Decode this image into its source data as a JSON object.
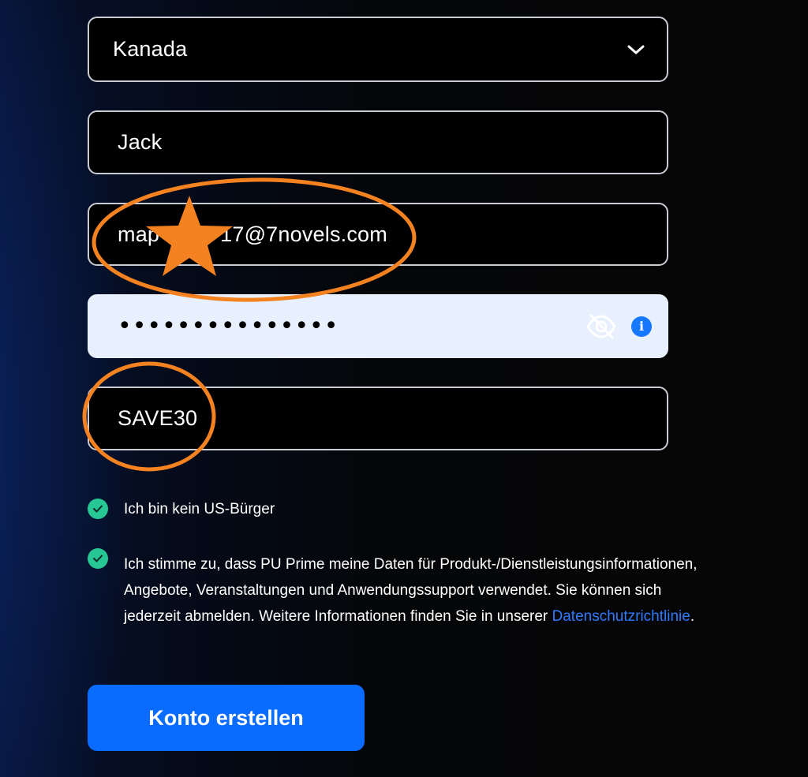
{
  "form": {
    "country": {
      "value": "Kanada"
    },
    "first_name": {
      "value": "Jack"
    },
    "email": {
      "value": "map          17@7novels.com"
    },
    "password": {
      "masked_value": "•••••••••••••••"
    },
    "promo_code": {
      "value": "SAVE30"
    }
  },
  "consents": [
    {
      "checked": true,
      "text": "Ich bin kein US-Bürger"
    },
    {
      "checked": true,
      "text": "Ich stimme zu, dass PU Prime meine Daten für Produkt-/Dienstleistungsinformationen, Angebote, Veranstaltungen und Anwendungssupport verwendet. Sie können sich jederzeit abmelden. Weitere Informationen finden Sie in unserer ",
      "link_text": "Datenschutzrichtlinie",
      "trailing": "."
    }
  ],
  "submit": {
    "label": "Konto erstellen"
  },
  "colors": {
    "accent": "#0a6cff",
    "check": "#27c793",
    "link": "#2e7bff",
    "annotation": "#f58220",
    "password_bg": "#e8f0fe"
  },
  "icons": {
    "country_dropdown": "chevron-down-icon",
    "password_visibility": "eye-off-icon",
    "password_info": "info-icon",
    "consent_check": "check-circle-icon",
    "annotation": "star-icon"
  }
}
